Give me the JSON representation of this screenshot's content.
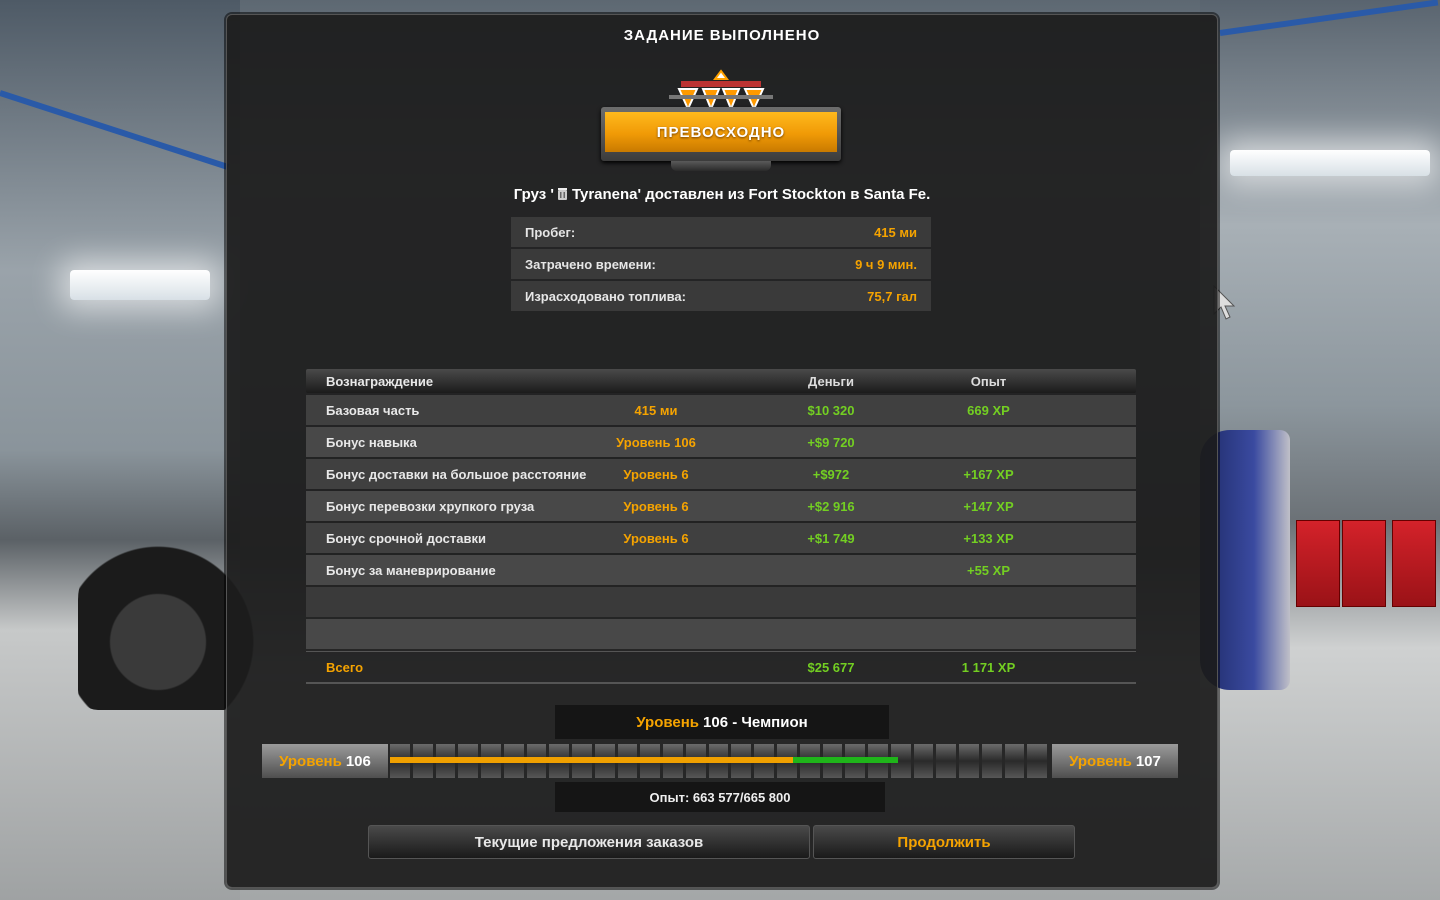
{
  "title": "ЗАДАНИЕ ВЫПОЛНЕНО",
  "rating": "ПРЕВОСХОДНО",
  "cargo": {
    "prefix": "Груз '",
    "name": "Tyranena' доставлен из Fort Stockton в Santa Fe."
  },
  "stats": [
    {
      "label": "Пробег:",
      "value": "415 ми"
    },
    {
      "label": "Затрачено времени:",
      "value": "9 ч 9 мин."
    },
    {
      "label": "Израсходовано топлива:",
      "value": "75,7 гал"
    }
  ],
  "rewards": {
    "headers": {
      "reward": "Вознаграждение",
      "money": "Деньги",
      "xp": "Опыт"
    },
    "rows": [
      {
        "label": "Базовая часть",
        "detail": "415 ми",
        "money": "$10 320",
        "xp": "669 XP"
      },
      {
        "label": "Бонус навыка",
        "detail": "Уровень 106",
        "money": "+$9 720",
        "xp": ""
      },
      {
        "label": "Бонус доставки на большое расстояние",
        "detail": "Уровень 6",
        "money": "+$972",
        "xp": "+167 XP"
      },
      {
        "label": "Бонус перевозки хрупкого груза",
        "detail": "Уровень 6",
        "money": "+$2 916",
        "xp": "+147 XP"
      },
      {
        "label": "Бонус срочной доставки",
        "detail": "Уровень 6",
        "money": "+$1 749",
        "xp": "+133 XP"
      },
      {
        "label": "Бонус за маневрирование",
        "detail": "",
        "money": "",
        "xp": "+55 XP"
      }
    ],
    "total": {
      "label": "Всего",
      "money": "$25 677",
      "xp": "1 171 XP"
    }
  },
  "level": {
    "label": "Уровень",
    "number": "106 - Чемпион",
    "current_label": "Уровень",
    "current_num": "106",
    "next_label": "Уровень",
    "next_num": "107",
    "progress_before": 0.61,
    "progress_gain": 0.16,
    "xp_text": "Опыт: 663 577/665 800"
  },
  "buttons": {
    "offers": "Текущие предложения заказов",
    "continue": "Продолжить"
  },
  "colors": {
    "accent": "#f5a300",
    "positive": "#73cf22"
  }
}
